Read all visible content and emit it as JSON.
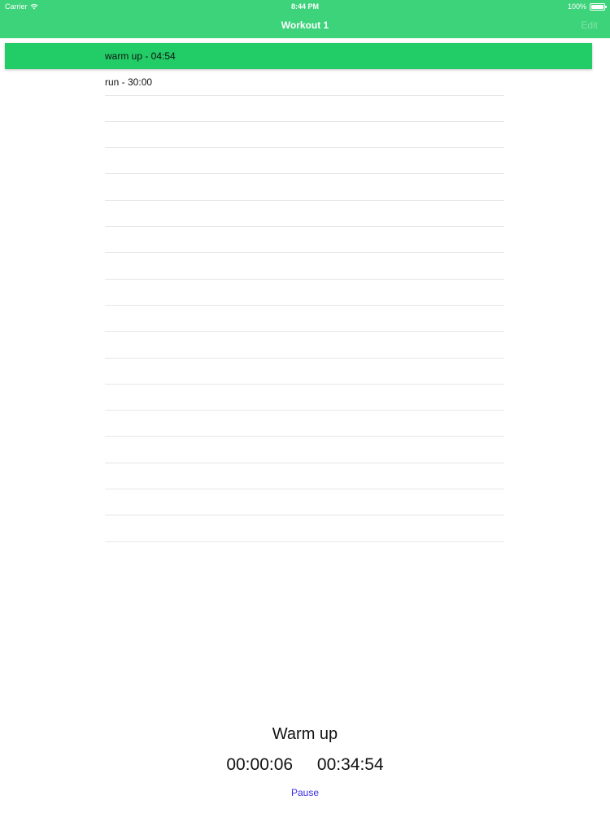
{
  "status": {
    "carrier": "Carrier",
    "time": "8:44 PM",
    "battery": "100%",
    "battery_level": 1.0
  },
  "nav": {
    "title": "Workout 1",
    "edit_label": "Edit"
  },
  "list": {
    "items": [
      {
        "label": "warm up - 04:54",
        "active": true
      },
      {
        "label": "run - 30:00",
        "active": false
      }
    ]
  },
  "timer": {
    "current_name": "Warm up",
    "elapsed": "00:00:06",
    "remaining": "00:34:54",
    "pause_label": "Pause"
  },
  "colors": {
    "header": "#3dd37a",
    "active_row": "#22cc66",
    "pause": "#3b2ee6"
  }
}
